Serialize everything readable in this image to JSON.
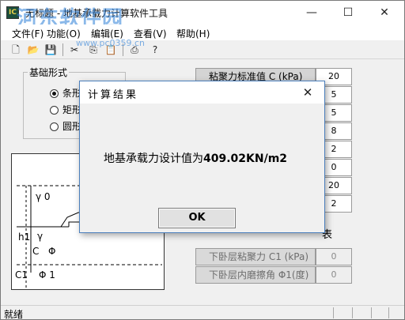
{
  "window": {
    "title": "无标题 - 地基承载力计算软件工具",
    "app_icon": "app-icon",
    "minimize": "—",
    "maximize": "☐",
    "close": "✕"
  },
  "watermark": {
    "text": "河东软件园",
    "sub": "www.pc0359.cn"
  },
  "menu": [
    "文件(F)",
    "功能(O)",
    "编辑(E)",
    "查看(V)",
    "帮助(H)"
  ],
  "toolbar": [
    {
      "icon": "new-file-icon",
      "glyph": "🗋"
    },
    {
      "icon": "open-folder-icon",
      "glyph": "📂"
    },
    {
      "icon": "save-icon",
      "glyph": "💾"
    },
    {
      "icon": "cut-icon",
      "glyph": "✂"
    },
    {
      "icon": "copy-icon",
      "glyph": "⎘"
    },
    {
      "icon": "paste-icon",
      "glyph": "📋"
    },
    {
      "icon": "print-icon",
      "glyph": "⎙"
    },
    {
      "icon": "help-icon",
      "glyph": "?"
    }
  ],
  "foundation": {
    "group_title": "基础形式",
    "options": [
      {
        "label": "条形",
        "selected": true
      },
      {
        "label": "矩形",
        "selected": false
      },
      {
        "label": "圆形",
        "selected": false
      }
    ]
  },
  "diagram": {
    "labels": [
      "γ 0",
      "h1",
      "γ",
      "C",
      "Φ",
      "C1",
      "Φ 1"
    ]
  },
  "params": [
    {
      "label": "粘聚力标准值 C (kPa)",
      "value": "20",
      "disabled": false
    },
    {
      "label": "",
      "value": "5",
      "disabled": false
    },
    {
      "label": "",
      "value": "5",
      "disabled": false
    },
    {
      "label": "",
      "value": "8",
      "disabled": false
    },
    {
      "label": "",
      "value": "2",
      "disabled": false
    },
    {
      "label": "",
      "value": "0",
      "disabled": false
    },
    {
      "label": "",
      "value": "20",
      "disabled": false
    },
    {
      "label": "",
      "value": "2",
      "disabled": false
    }
  ],
  "stray_char": "表",
  "params_disabled": [
    {
      "label": "下卧层粘聚力 C1 (kPa)",
      "value": "0"
    },
    {
      "label": "下卧层内磨擦角 Φ1(度)",
      "value": "0"
    }
  ],
  "status": {
    "text": "就绪"
  },
  "dialog": {
    "title": "计算结果",
    "message_prefix": "地基承载力设计值为",
    "message_value": "409.02KN/m2",
    "ok_label": "OK",
    "close_glyph": "✕"
  }
}
